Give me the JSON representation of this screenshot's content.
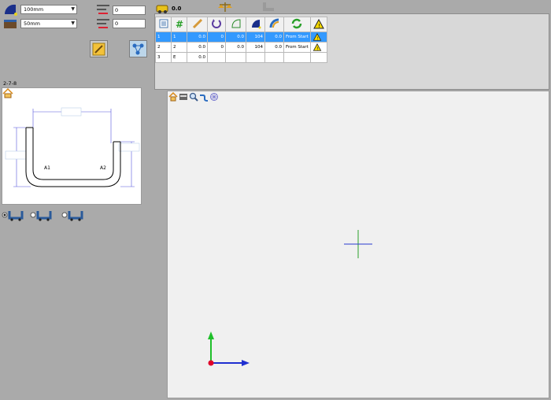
{
  "toolbar": {
    "radius_select": "100mm",
    "size_select": "50mm",
    "field_a_value": "0",
    "field_b_value": "0",
    "cost_value": "0.0"
  },
  "table": {
    "columns": [
      "list-icon",
      "number-icon",
      "length-icon",
      "rotate-icon",
      "bend-angle-icon",
      "radius-icon",
      "springback-icon",
      "refresh-icon",
      "warning-icon"
    ],
    "rows": [
      {
        "id": "1",
        "n": "1",
        "len": "0.0",
        "rot": "0",
        "ang": "0.0",
        "rad": "104",
        "sb": "0.0",
        "mode": "From Start",
        "warn": true
      },
      {
        "id": "2",
        "n": "2",
        "len": "0.0",
        "rot": "0",
        "ang": "0.0",
        "rad": "104",
        "sb": "0.0",
        "mode": "From Start",
        "warn": true
      },
      {
        "id": "3",
        "n": "E",
        "len": "0.0",
        "rot": "",
        "ang": "",
        "rad": "",
        "sb": "",
        "mode": "",
        "warn": false
      }
    ]
  },
  "diagram": {
    "title": "2-7-8",
    "label_a1": "A1",
    "label_a2": "A2"
  },
  "colors": {
    "selected_row": "#3399ff",
    "axis_x": "#1f2fd0",
    "axis_y": "#1fbf2a",
    "origin": "#e0002a"
  }
}
